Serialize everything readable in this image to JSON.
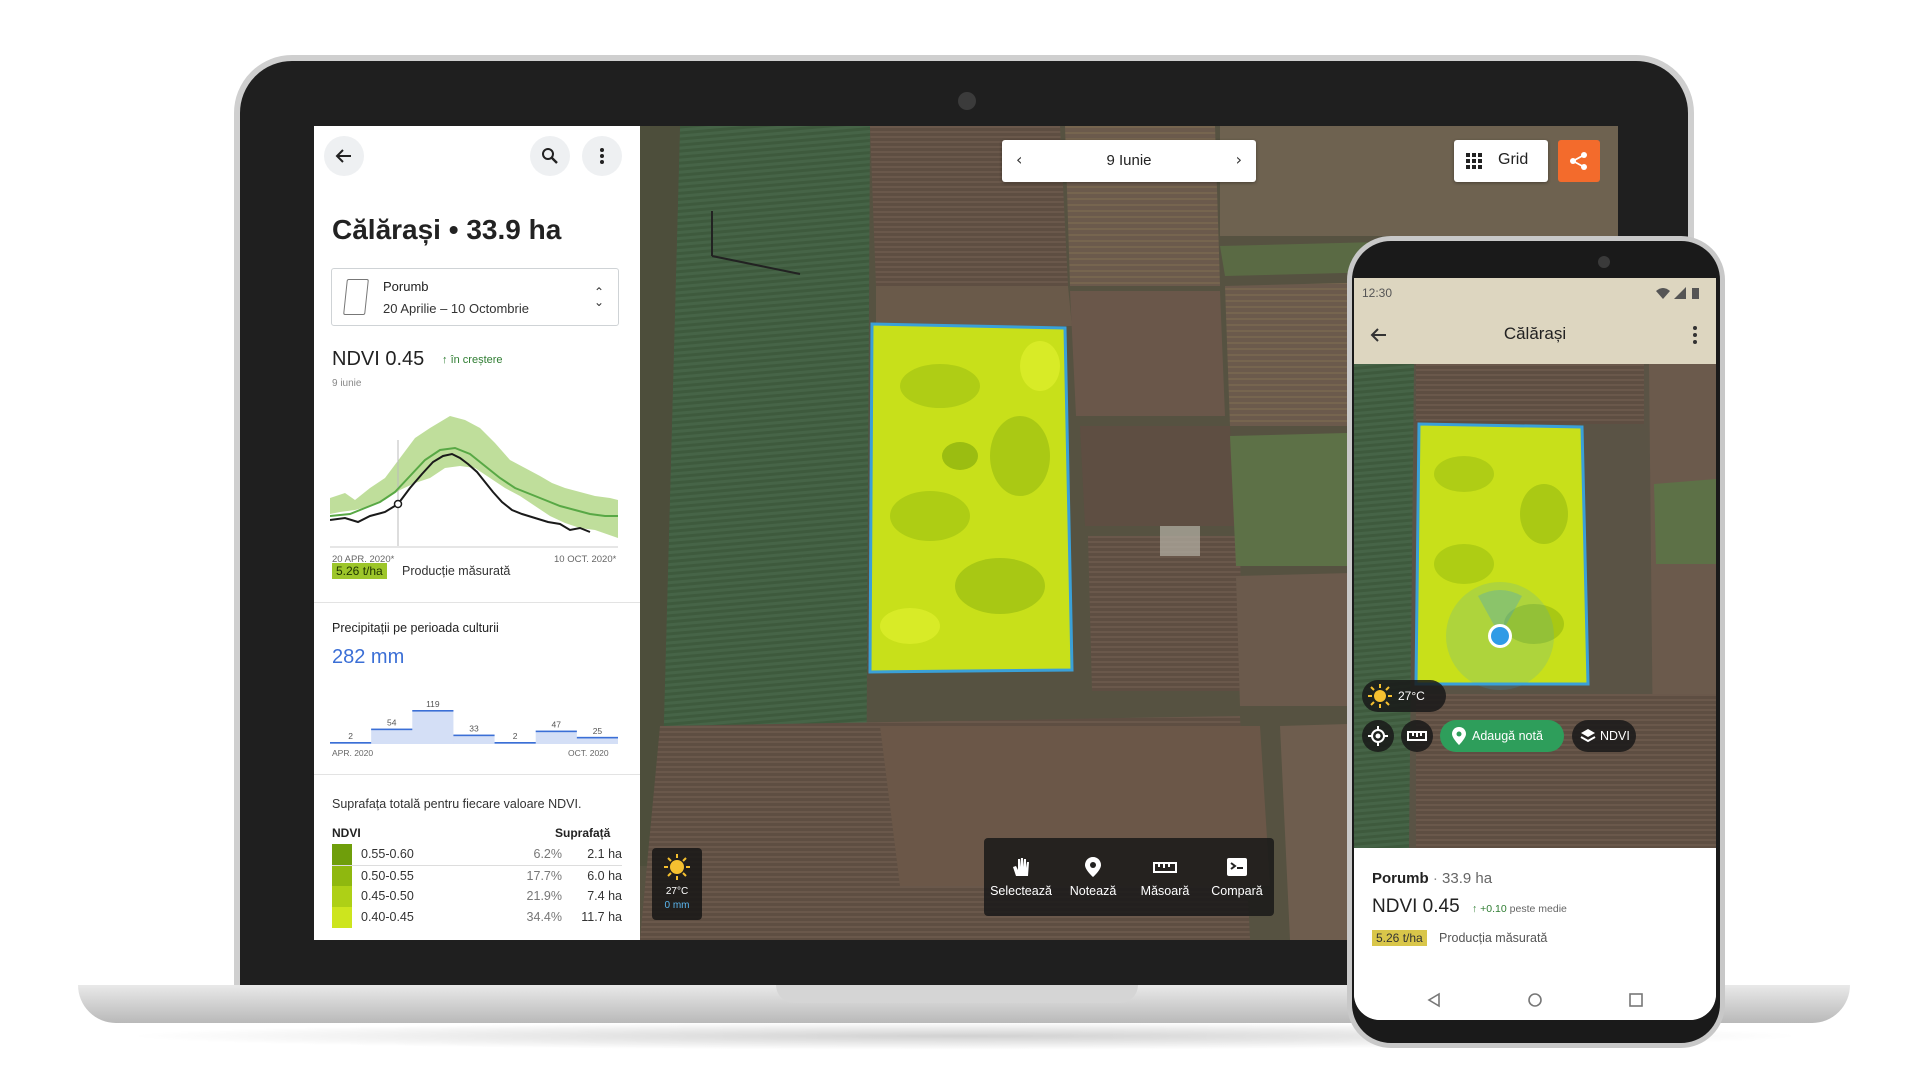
{
  "laptop": {
    "panel": {
      "title": "Călărași • 33.9 ha",
      "crop": {
        "name": "Porumb",
        "dates": "20 Aprilie – 10 Octombrie"
      },
      "ndvi": {
        "label": "NDVI 0.45",
        "trend": "în creștere",
        "date": "9 iunie"
      },
      "ndvi_axis": {
        "start": "20 APR. 2020*",
        "end": "10 OCT. 2020*"
      },
      "production": {
        "badge": "5.26 t/ha",
        "label": "Producție măsurată"
      },
      "precip": {
        "title": "Precipitații pe perioada culturii",
        "value": "282 mm",
        "axis_start": "APR. 2020",
        "axis_end": "OCT. 2020"
      },
      "surface": {
        "title": "Suprafața totală pentru fiecare valoare NDVI.",
        "col_ndvi": "NDVI",
        "col_area": "Suprafață",
        "rows": [
          {
            "range": "0.55-0.60",
            "pct": "6.2%",
            "ha": "2.1 ha",
            "color": "#6f9e0b"
          },
          {
            "range": "0.50-0.55",
            "pct": "17.7%",
            "ha": "6.0 ha",
            "color": "#8fb80f"
          },
          {
            "range": "0.45-0.50",
            "pct": "21.9%",
            "ha": "7.4 ha",
            "color": "#aed016"
          },
          {
            "range": "0.40-0.45",
            "pct": "34.4%",
            "ha": "11.7 ha",
            "color": "#cde51e"
          }
        ]
      }
    },
    "map": {
      "date": "9 Iunie",
      "grid_label": "Grid",
      "weather": {
        "temp": "27°C",
        "rain": "0 mm"
      },
      "tools": [
        "Selectează",
        "Notează",
        "Măsoară",
        "Compară"
      ]
    }
  },
  "phone": {
    "time": "12:30",
    "title": "Călărași",
    "weather_temp": "27°C",
    "add_note": "Adaugă notă",
    "ndvi_btn": "NDVI",
    "crop": "Porumb",
    "area": "33.9 ha",
    "ndvi": "NDVI 0.45",
    "delta": "+0.10",
    "delta_label": "peste medie",
    "prod_badge": "5.26 t/ha",
    "prod_label": "Producția măsurată"
  },
  "chart_data": [
    {
      "type": "line",
      "title": "NDVI 0.45",
      "x": [
        "20 APR. 2020*",
        "10 OCT. 2020*"
      ],
      "series": [],
      "ylim": [
        0,
        1
      ]
    },
    {
      "type": "bar",
      "title": "Precipitații pe perioada culturii",
      "categories": [
        "APR. 2020",
        "",
        "",
        "",
        "",
        "",
        "OCT. 2020"
      ],
      "values": [
        2,
        54,
        119,
        33,
        2,
        47,
        25
      ]
    }
  ],
  "colors": {
    "accent_share": "#f36b2c",
    "ndvi_field": "#c8e01a",
    "precip": "#3b6fd6",
    "add_note": "#2e9e5b"
  }
}
